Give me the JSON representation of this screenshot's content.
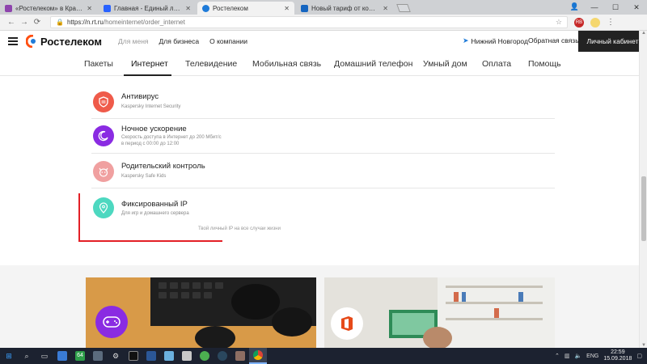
{
  "browser": {
    "tabs": [
      {
        "title": "«Ростелеком» в Красноярске -",
        "favicon_color": "#8e44ad",
        "active": false
      },
      {
        "title": "Главная - Единый личный каби",
        "favicon_color": "#2962ff",
        "active": false
      },
      {
        "title": "Ростелеком",
        "favicon_color": "#1f7bd9",
        "active": true
      },
      {
        "title": "Новый тариф от компании Ро:",
        "favicon_color": "#1565c0",
        "active": false
      }
    ],
    "url_host": "https://n.rt.ru",
    "url_path": "/homeinternet/order_internet",
    "extension_badge": "RB"
  },
  "header": {
    "logo_text": "Ростелеком",
    "nav": [
      {
        "label": "Для меня",
        "muted": true
      },
      {
        "label": "Для бизнеса",
        "muted": false
      },
      {
        "label": "О компании",
        "muted": false
      }
    ],
    "city": "Нижний Новгород",
    "feedback": "Обратная связь",
    "cabinet": "Личный кабинет"
  },
  "menu": {
    "items": [
      "Пакеты",
      "Интернет",
      "Телевидение",
      "Мобильная связь",
      "Домашний телефон",
      "Умный дом",
      "Оплата",
      "Помощь"
    ],
    "active": "Интернет"
  },
  "services": [
    {
      "name": "Антивирус",
      "sub1": "Kaspersky Internet Security",
      "sub2": "",
      "color": "#ef5b4a",
      "icon": "shield-icon"
    },
    {
      "name": "Ночное ускорение",
      "sub1": "Скорость доступа в Интернет до 200 Мбит/с",
      "sub2": "в период с 00:00 до 12:00",
      "color": "#8a2be2",
      "icon": "moon-icon"
    },
    {
      "name": "Родительский контроль",
      "sub1": "Kaspersky Safe Kids",
      "sub2": "",
      "color": "#f0a0a0",
      "icon": "cat-icon"
    },
    {
      "name": "Фиксированный IP",
      "sub1": "Для игр и домашнего сервера",
      "sub2": "",
      "color": "#4dd8c0",
      "icon": "location-pin-icon"
    }
  ],
  "fixed_ip_note": "Твой личный IP на все случаи жизни",
  "accent_color": "#e32026",
  "taskbar": {
    "lang": "ENG",
    "time": "22:59",
    "date": "15.09.2018",
    "app_badge": "64"
  }
}
